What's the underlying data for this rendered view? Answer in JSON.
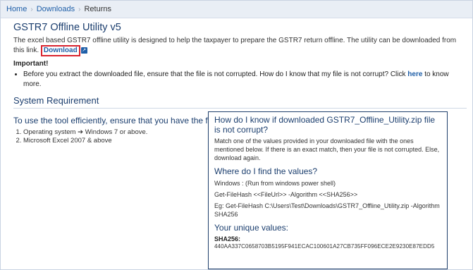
{
  "breadcrumb": {
    "items": [
      "Home",
      "Downloads"
    ],
    "separator": "›",
    "current": "Returns"
  },
  "page": {
    "title": "GSTR7 Offline Utility v5",
    "intro": "The excel based GSTR7 offline utility is designed to help the taxpayer to prepare the GSTR7 return offline. The utility can be downloaded from this link.",
    "download_label": "Download",
    "download_icon": "external-link-icon",
    "important_label": "Important!",
    "note_text": "Before you extract the downloaded file, ensure that the file is not corrupted. How do I know that my file is not corrupt? Click",
    "note_link": "here",
    "note_tail": "to know more."
  },
  "system": {
    "heading": "System Requirement",
    "lead": "To use the tool efficiently, ensure that you have the following installed on your system:",
    "requirements": [
      {
        "prefix": "Operating system",
        "arrow": "➔",
        "value": "Windows 7 or above."
      },
      {
        "text": "Microsoft Excel 2007 & above"
      }
    ]
  },
  "panel": {
    "title": "How do I know if downloaded GSTR7_Offline_Utility.zip file is not corrupt?",
    "match_text": "Match one of the values provided in your downloaded file with the ones mentioned below. If there is an exact match, then your file is not corrupted. Else, download again.",
    "find_heading": "Where do I find the values?",
    "windows_text": "Windows : (Run from windows power shell)",
    "command_text": "Get-FileHash <<FileUrl>> -Algorithm <<SHA256>>",
    "example_text": "Eg: Get-FileHash C:\\Users\\Test\\Downloads\\GSTR7_Offline_Utility.zip -Algorithm SHA256",
    "unique_heading": "Your unique values:",
    "sha_label": "SHA256:",
    "sha_value": "440AA337C0658703B5195F941ECAC100601A27CB735FF096ECE2E9230E87EDD5"
  },
  "colors": {
    "heading_blue": "#1b3e6e",
    "link_blue": "#1f5fa8",
    "highlight_red": "#d9232d",
    "breadcrumb_bg": "#e9eef5"
  }
}
